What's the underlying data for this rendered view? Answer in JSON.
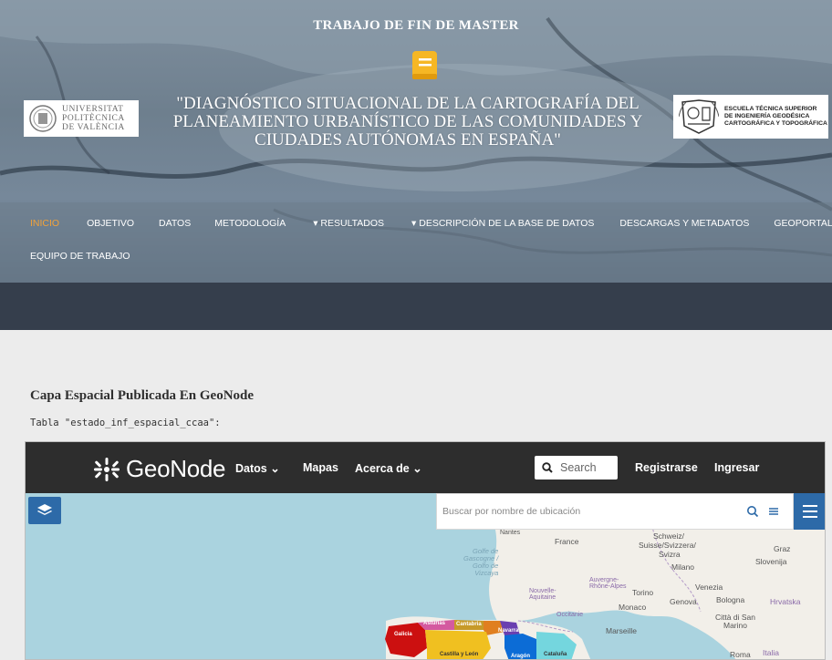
{
  "header": {
    "kicker": "TRABAJO DE FIN DE MASTER",
    "title_lines": [
      "\"DIAGNÓSTICO SITUACIONAL DE LA CARTOGRAFÍA DEL",
      "PLANEAMIENTO URBANÍSTICO DE LAS COMUNIDADES Y",
      "CIUDADES AUTÓNOMAS EN ESPAÑA\""
    ],
    "logo_left_lines": [
      "UNIVERSITAT",
      "POLITÈCNICA",
      "DE VALÈNCIA"
    ],
    "logo_right_lines": [
      "ESCUELA TÉCNICA SUPERIOR",
      "DE INGENIERÍA GEODÉSICA",
      "CARTOGRÁFICA Y TOPOGRÁFICA"
    ],
    "accent_color": "#f1a23a",
    "book_icon": "book-icon"
  },
  "nav": {
    "items": [
      {
        "label": "INICIO",
        "active": true
      },
      {
        "label": "OBJETIVO"
      },
      {
        "label": "DATOS"
      },
      {
        "label": "METODOLOGÍA"
      },
      {
        "label": "▾ RESULTADOS"
      },
      {
        "label": "▾ DESCRIPCIÓN DE LA BASE DE DATOS"
      },
      {
        "label": "DESCARGAS Y METADATOS"
      },
      {
        "label": "GEOPORTAL"
      },
      {
        "label": "EQUIPO DE TRABAJO"
      }
    ]
  },
  "content": {
    "section_title": "Capa Espacial Publicada En GeoNode",
    "caption": "Tabla \"estado_inf_espacial_ccaa\":"
  },
  "geonode": {
    "brand": "GeoNode",
    "menu": {
      "datos": "Datos ⌄",
      "mapas": "Mapas",
      "acerca": "Acerca de ⌄",
      "register": "Registrarse",
      "login": "Ingresar"
    },
    "search_placeholder": "Search",
    "map_search_placeholder": "Buscar por nombre de ubicación",
    "map_labels": {
      "nantes": "Nantes",
      "france": "France",
      "schweiz": "Schweiz/",
      "suisse": "Suisse/Svizzera/",
      "svizra": "Svizra",
      "graz": "Graz",
      "slovenija": "Slovenija",
      "golfe": "Golfe de\nGascogne /\nGolfo de\nVizcaya",
      "auvergne": "Auvergne-\nRhône-Alpes",
      "milano": "Milano",
      "nouvelle": "Nouvelle-\nAquitaine",
      "torino": "Torino",
      "venezia": "Venezia",
      "monaco": "Monaco",
      "genova": "Genova",
      "bologna": "Bologna",
      "hrvatska": "Hrvatska",
      "occitanie": "Occitanie",
      "marseille": "Marseille",
      "citta": "Città di San\nMarino",
      "roma": "Roma",
      "italia": "Italia"
    },
    "regions": [
      "Galicia",
      "Asturias",
      "Cantabria",
      "Navarra",
      "Castilla y León",
      "Aragón",
      "Cataluña"
    ]
  }
}
